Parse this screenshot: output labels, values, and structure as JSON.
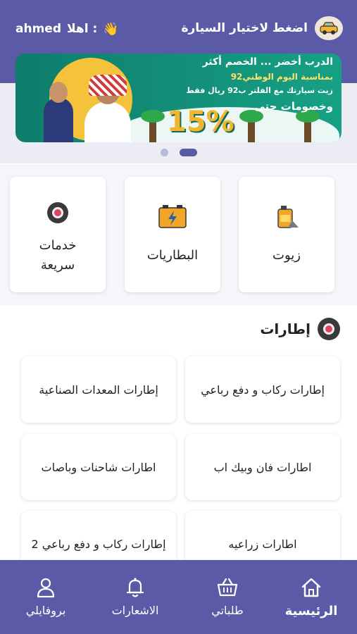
{
  "header": {
    "greeting_label": "اهلا :",
    "username": "ahmed",
    "car_select_label": "اضغط لاختيار السيارة"
  },
  "banner": {
    "line1": "الدرب أخضر ... الخصم أكثر",
    "line2": "بمناسبة اليوم الوطني92",
    "line3": "زيت سيارتك مع الفلتر ب92 ريال فقط",
    "line4": "وخصومات حتى",
    "percent": "15%"
  },
  "carousel": {
    "count": 2,
    "active_index": 1
  },
  "services": [
    {
      "label": "زيوت",
      "icon": "oil-can-icon"
    },
    {
      "label": "البطاريات",
      "icon": "battery-icon"
    },
    {
      "label": "خدمات سريعة",
      "icon": "tire-icon"
    }
  ],
  "section": {
    "title": "إطارات",
    "categories": [
      "إطارات ركاب و دفع رباعي",
      "إطارات المعدات الصناعية",
      "اطارات فان وبيك اب",
      "اطارات شاحنات وباصات",
      "اطارات زراعيه",
      "إطارات ركاب و دفع رباعي 2"
    ]
  },
  "nav": {
    "home": "الرئيسية",
    "orders": "طلباتي",
    "notifications": "الاشعارات",
    "profile": "بروفايلي"
  },
  "colors": {
    "primary": "#5b5aa6",
    "band": "#ececf4",
    "dot_inactive": "#b7b8da"
  }
}
